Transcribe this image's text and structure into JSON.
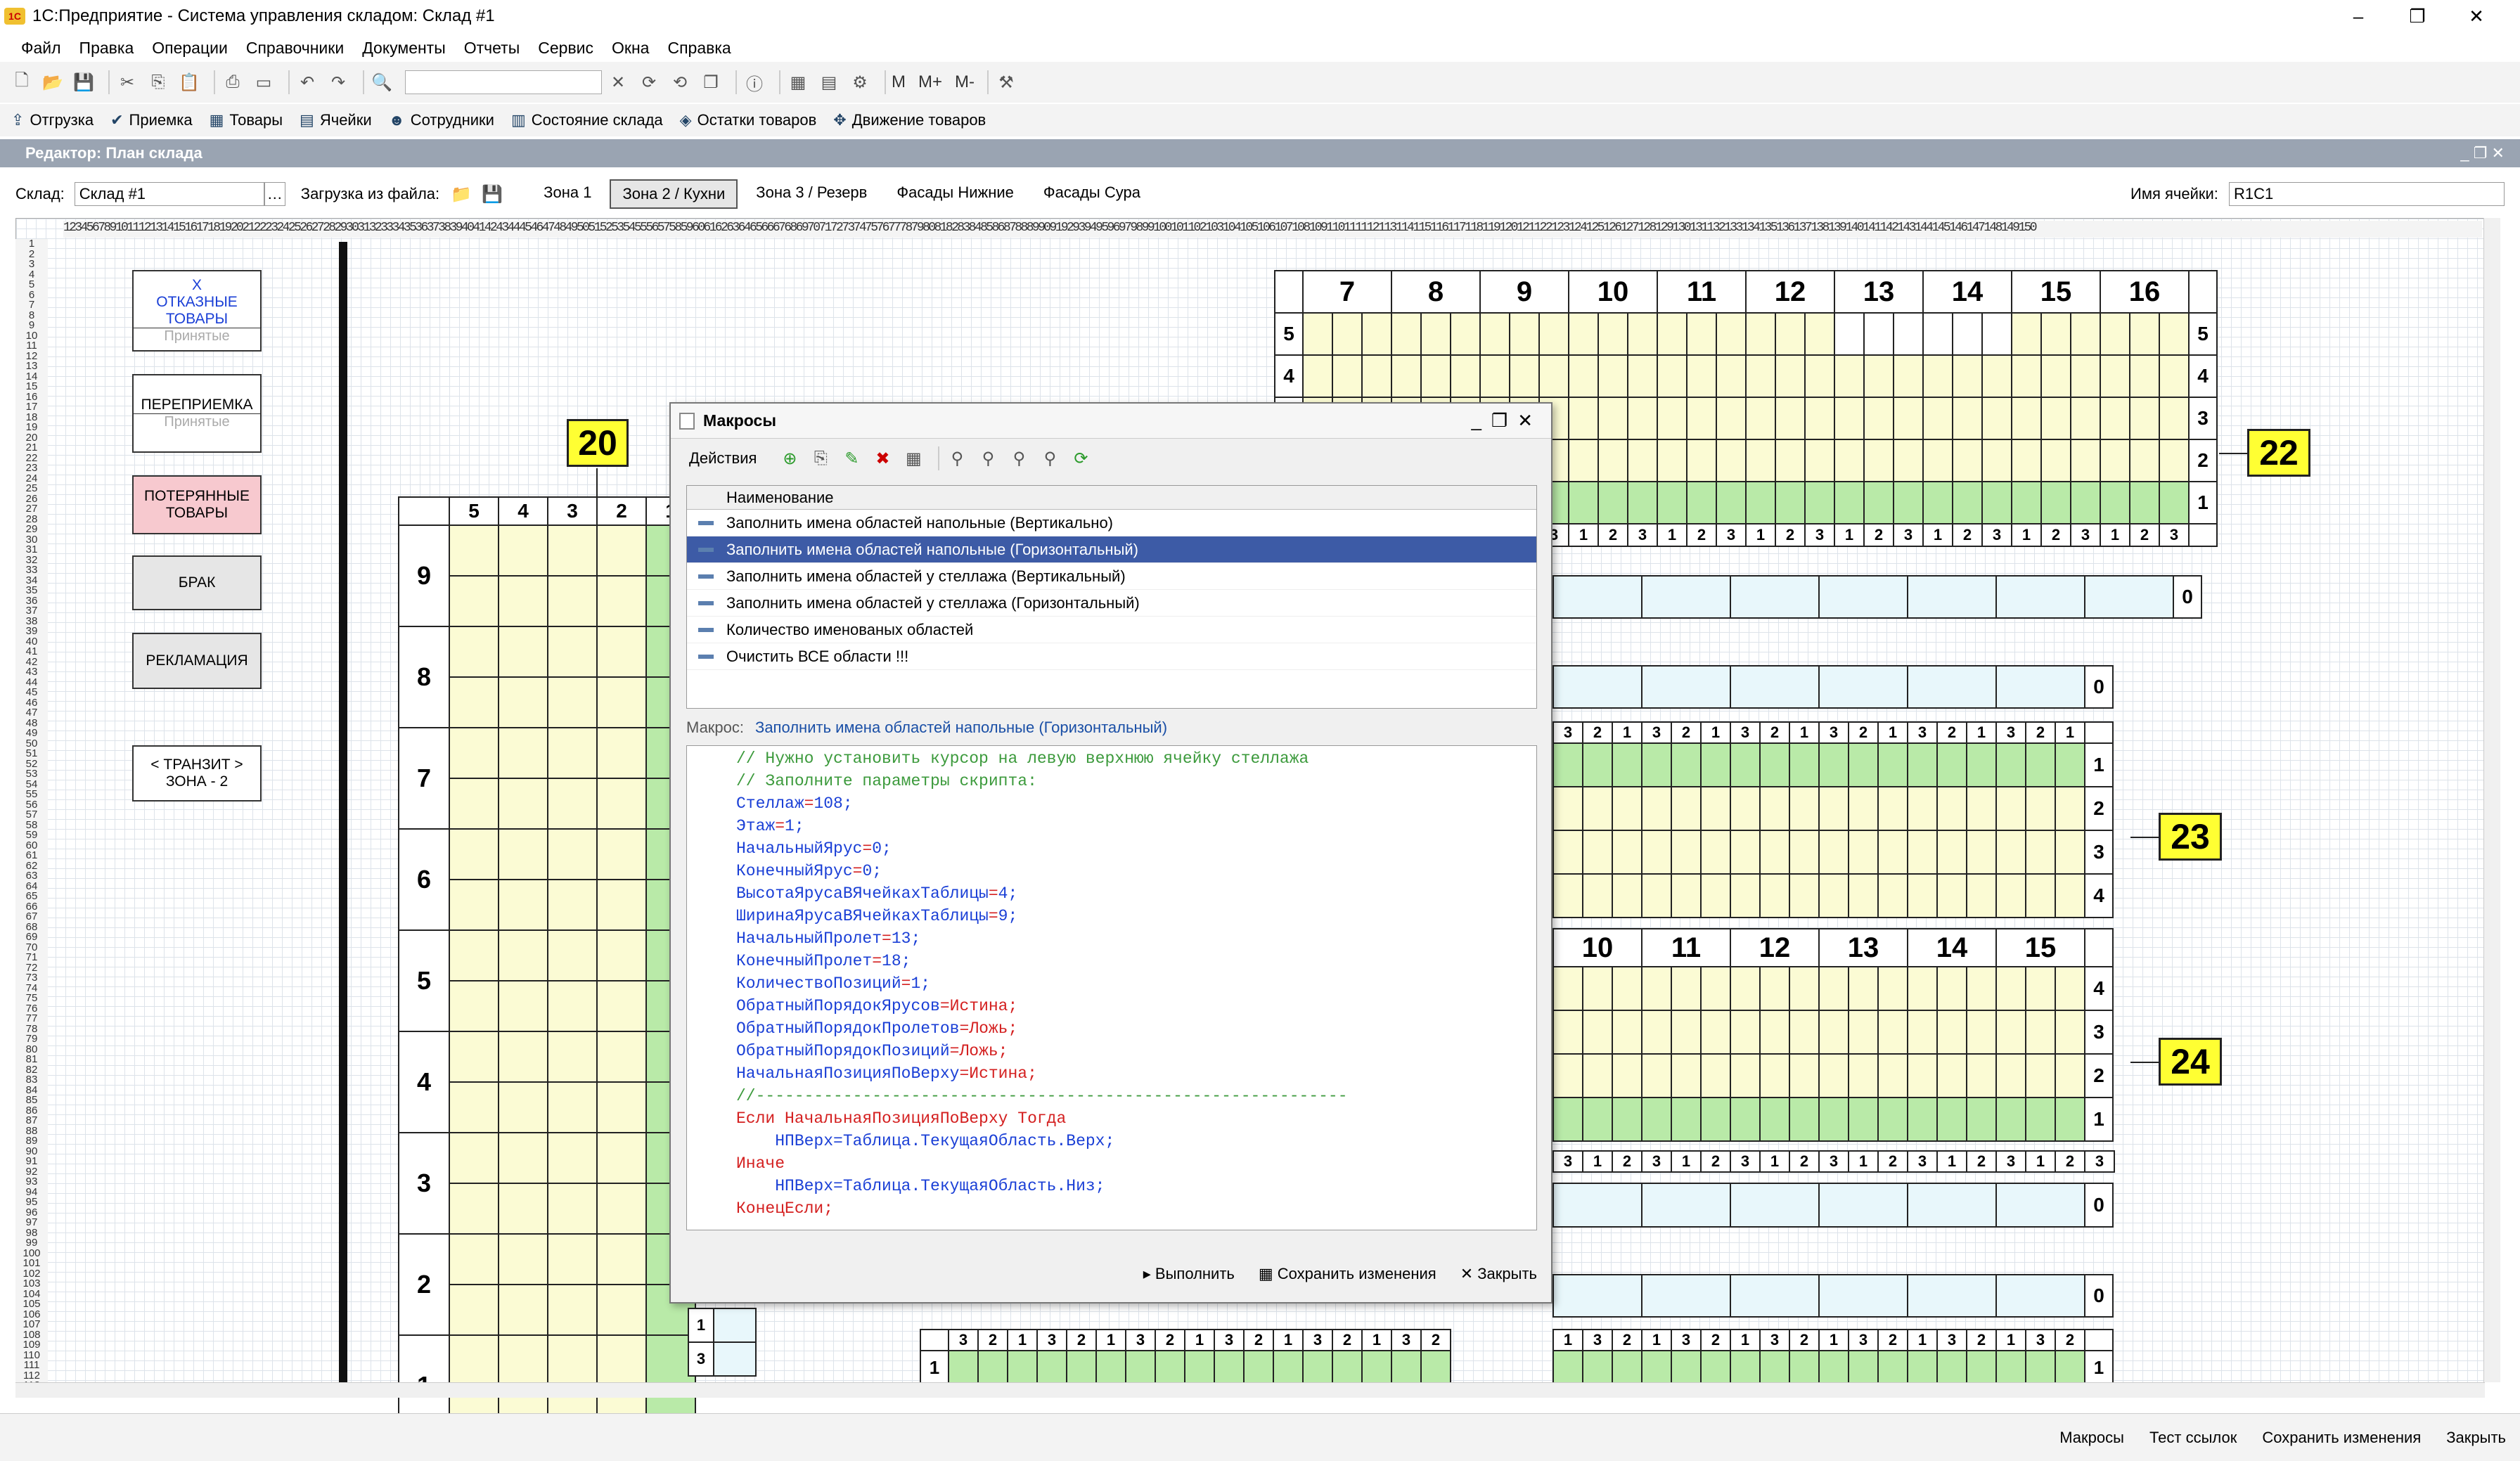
{
  "window": {
    "title": "1С:Предприятие - Система управления складом: Склад #1",
    "min": "–",
    "max": "❐",
    "close": "✕"
  },
  "menu": [
    "Файл",
    "Правка",
    "Операции",
    "Справочники",
    "Документы",
    "Отчеты",
    "Сервис",
    "Окна",
    "Справка"
  ],
  "toolbar2": [
    {
      "icon": "⇪",
      "label": "Отгрузка"
    },
    {
      "icon": "✔",
      "label": "Приемка"
    },
    {
      "icon": "▦",
      "label": "Товары"
    },
    {
      "icon": "▤",
      "label": "Ячейки"
    },
    {
      "icon": "☻",
      "label": "Сотрудники"
    },
    {
      "icon": "▥",
      "label": "Состояние склада"
    },
    {
      "icon": "◈",
      "label": "Остатки товаров"
    },
    {
      "icon": "✥",
      "label": "Движение товаров"
    }
  ],
  "toolbar1": {
    "m": "M",
    "mplus": "M+",
    "mminus": "M-"
  },
  "editor": {
    "title": "Редактор: План склада"
  },
  "form": {
    "sklad_label": "Склад:",
    "sklad_value": "Склад #1",
    "load_label": "Загрузка из файла:",
    "cell_label": "Имя ячейки:",
    "cell_value": "R1C1",
    "zones": [
      "Зона 1",
      "Зона 2 / Кухни",
      "Зона 3 / Резерв",
      "Фасады Нижние",
      "Фасады Сура"
    ]
  },
  "colhdr": "123456789101112131415161718192021222324252627282930313233343536373839404142434445464748495051525354555657585960616263646566676869707172737475767778798081828384858687888990919293949596979899100101102103104105106107108109110111112113114115116117118119120121122123124125126127128129130131132133134135136137138139140141142143144145146147148149150",
  "side_buttons": [
    {
      "label": "Х\nОТКАЗНЫЕ\nТОВАРЫ",
      "sub": "Принятые",
      "color": "#fff",
      "text": "#1a3fd6"
    },
    {
      "label": "ПЕРЕПРИЕМКА",
      "sub": "Принятые",
      "color": "#fff",
      "text": "#000"
    },
    {
      "label": "ПОТЕРЯННЫЕ\nТОВАРЫ",
      "sub": "",
      "color": "#f7c9cf",
      "text": "#000"
    },
    {
      "label": "БРАК",
      "sub": "",
      "color": "#e6e6e6",
      "text": "#000"
    },
    {
      "label": "РЕКЛАМАЦИЯ",
      "sub": "",
      "color": "#e6e6e6",
      "text": "#000"
    },
    {
      "label": "< ТРАНЗИТ >\nЗОНА - 2",
      "sub": "",
      "color": "#fff",
      "text": "#000"
    }
  ],
  "rack20": {
    "tag": "20",
    "cols": [
      "5",
      "4",
      "3",
      "2",
      "1"
    ],
    "rows": [
      "9",
      "8",
      "7",
      "6",
      "5",
      "4",
      "3",
      "2",
      "1"
    ]
  },
  "rack22": {
    "tag": "22",
    "cols": [
      "7",
      "8",
      "9",
      "10",
      "11",
      "12",
      "13",
      "14",
      "15",
      "16"
    ],
    "levels": [
      "5",
      "4",
      "3",
      "2",
      "1"
    ],
    "pos": [
      "3",
      "1",
      "2",
      "3",
      "1",
      "2",
      "3",
      "1",
      "2",
      "3",
      "1",
      "2",
      "3",
      "1",
      "2",
      "3",
      "1",
      "2",
      "3",
      "1",
      "2",
      "3",
      "1",
      "2",
      "3",
      "1",
      "2",
      "3",
      "1",
      "2",
      "3"
    ],
    "zero": "0"
  },
  "rack23": {
    "tag": "23",
    "levels": [
      "1",
      "2",
      "3",
      "4"
    ],
    "pos": [
      "3",
      "2",
      "1",
      "3",
      "2",
      "1",
      "3",
      "2",
      "1",
      "3",
      "2",
      "1",
      "3",
      "2",
      "1",
      "3",
      "2",
      "1"
    ],
    "zero": "0"
  },
  "rack24": {
    "tag": "24",
    "cols": [
      "10",
      "11",
      "12",
      "13",
      "14",
      "15"
    ],
    "levels": [
      "4",
      "3",
      "2",
      "1"
    ],
    "pos": [
      "3",
      "1",
      "2",
      "3",
      "1",
      "2",
      "3",
      "1",
      "2",
      "3",
      "1",
      "2",
      "3",
      "1",
      "2",
      "3",
      "1",
      "2",
      "3",
      "1",
      "2",
      "3",
      "1",
      "2",
      "3"
    ],
    "zero": "0",
    "zero2": "0"
  },
  "rackbottom": {
    "pos": [
      "3",
      "2",
      "1",
      "3",
      "2",
      "1",
      "3",
      "2",
      "1",
      "3",
      "2",
      "1",
      "3",
      "2",
      "1",
      "3",
      "2",
      "1",
      "3",
      "2",
      "1",
      "3",
      "2",
      "1",
      "3",
      "2",
      "1",
      "3",
      "2",
      "1",
      "3",
      "2",
      "1",
      "3",
      "2",
      "1",
      "3",
      "2",
      "1",
      "3",
      "2",
      "1"
    ],
    "level": "1",
    "side": [
      "1",
      "3"
    ]
  },
  "dialog": {
    "title": "Макросы",
    "actions": "Действия",
    "col": "Наименование",
    "items": [
      "Заполнить имена областей напольные (Вертикально)",
      "Заполнить имена областей напольные (Горизонтальный)",
      "Заполнить имена областей у стеллажа (Вертикальный)",
      "Заполнить имена областей у стеллажа (Горизонтальный)",
      "Количество именованых областей",
      "Очистить ВСЕ области !!!"
    ],
    "macro_label": "Макрос:",
    "macro_name": "Заполнить имена областей напольные (Горизонтальный)",
    "run": "Выполнить",
    "save": "Сохранить изменения",
    "close": "Закрыть"
  },
  "code": [
    {
      "t": "// Нужно установить курсор на левую верхнюю ячейку стеллажа",
      "c": "cmt"
    },
    {
      "t": "// Заполните параметры скрипта:",
      "c": "cmt"
    },
    {
      "k": "Стеллаж",
      "v": "108;"
    },
    {
      "k": "Этаж",
      "v": "1;"
    },
    {
      "k": "НачальныйЯрус",
      "v": "0;"
    },
    {
      "k": "КонечныйЯрус",
      "v": "0;"
    },
    {
      "k": "ВысотаЯрусаВЯчейкахТаблицы",
      "v": "4;"
    },
    {
      "k": "ШиринаЯрусаВЯчейкахТаблицы",
      "v": "9;"
    },
    {
      "k": "НачальныйПролет",
      "v": "13;"
    },
    {
      "k": "КонечныйПролет",
      "v": "18;"
    },
    {
      "k": "КоличествоПозиций",
      "v": "1;"
    },
    {
      "k": "ОбратныйПорядокЯрусов",
      "v": "Истина;"
    },
    {
      "k": "ОбратныйПорядокПролетов",
      "v": "Ложь;"
    },
    {
      "k": "ОбратныйПорядокПозиций",
      "v": "Ложь;"
    },
    {
      "k": "НачальнаяПозицияПоВерху",
      "v": "Истина;"
    },
    {
      "t": "//-------------------------------------------------------------",
      "c": "cmt"
    },
    {
      "t": "Если НачальнаяПозицияПоВерху Тогда",
      "c": "kw"
    },
    {
      "t": "    НПВерх=Таблица.ТекущаяОбласть.Верх;",
      "c": "id"
    },
    {
      "t": "Иначе",
      "c": "kw"
    },
    {
      "t": "    НПВерх=Таблица.ТекущаяОбласть.Низ;",
      "c": "id"
    },
    {
      "t": "КонецЕсли;",
      "c": "kw"
    }
  ],
  "status": [
    "Макросы",
    "Тест ссылок",
    "Сохранить изменения",
    "Закрыть"
  ]
}
